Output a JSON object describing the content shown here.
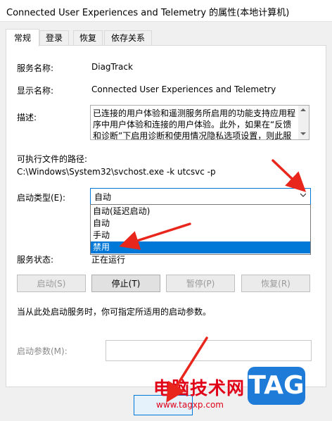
{
  "window": {
    "title": "Connected User Experiences and Telemetry 的属性(本地计算机)"
  },
  "tabs": [
    {
      "label": "常规",
      "active": true
    },
    {
      "label": "登录"
    },
    {
      "label": "恢复"
    },
    {
      "label": "依存关系"
    }
  ],
  "general": {
    "service_name_label": "服务名称:",
    "service_name_value": "DiagTrack",
    "display_name_label": "显示名称:",
    "display_name_value": "Connected User Experiences and Telemetry",
    "description_label": "描述:",
    "description_text": "已连接的用户体验和遥测服务所启用的功能支持应用程序中用户体验和连接的用户体验。此外，如果在“反馈和诊断”下启用诊断和使用情况隐私选项设置，则此服",
    "exe_path_label": "可执行文件的路径:",
    "exe_path_value": "C:\\Windows\\System32\\svchost.exe -k utcsvc -p",
    "startup_type_label": "启动类型(E):",
    "startup_type_value": "自动",
    "startup_options": [
      "自动(延迟启动)",
      "自动",
      "手动",
      "禁用"
    ],
    "service_status_label": "服务状态:",
    "service_status_value": "正在运行",
    "buttons": {
      "start": "启动(S)",
      "stop": "停止(T)",
      "pause": "暂停(P)",
      "resume": "恢复(R)"
    },
    "hint_text": "当从此处启动服务时，你可指定所适用的启动参数。",
    "start_params_label": "启动参数(M):"
  },
  "watermark": {
    "text": "电脑技术网",
    "url": "www.tagxp.com",
    "logo": "TAG"
  },
  "colors": {
    "selection": "#0078d7",
    "annotation_arrow": "#e8261c",
    "logo_blue": "#1e7bd8"
  }
}
